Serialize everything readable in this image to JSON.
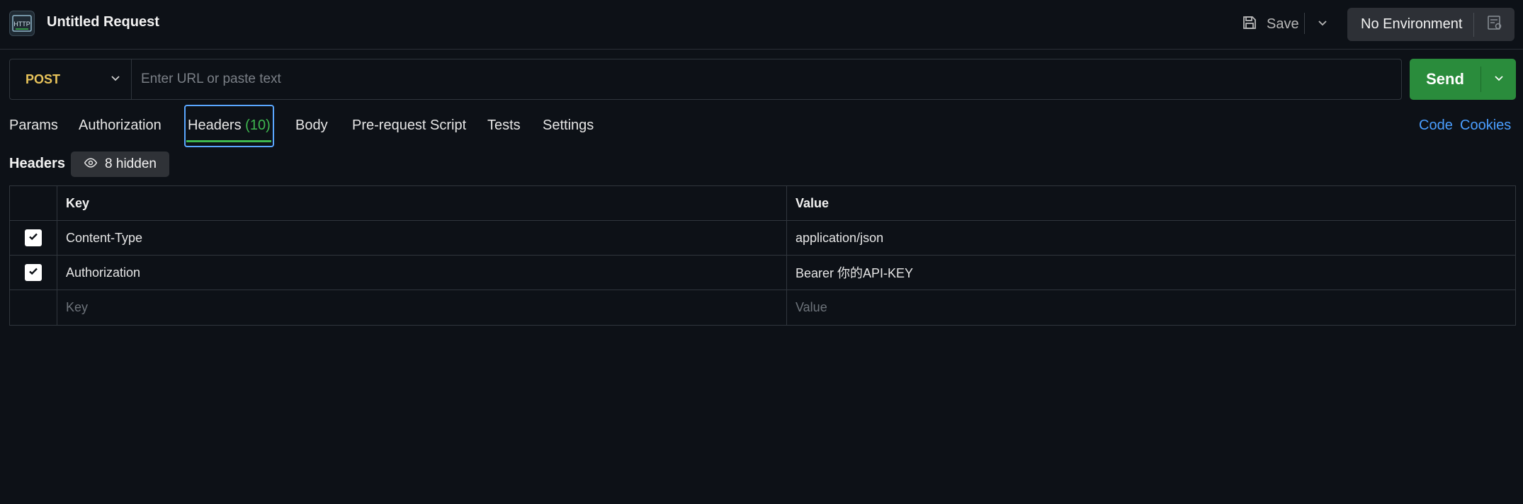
{
  "header": {
    "app_icon_text": "HTTP",
    "title": "Untitled Request",
    "save_label": "Save",
    "environment_label": "No Environment"
  },
  "request": {
    "method": "POST",
    "url_placeholder": "Enter URL or paste text",
    "url_value": "",
    "send_label": "Send"
  },
  "tabs": {
    "params": "Params",
    "authorization": "Authorization",
    "headers": "Headers",
    "headers_count": "(10)",
    "body": "Body",
    "prerequest": "Pre-request Script",
    "tests": "Tests",
    "settings": "Settings",
    "active": "headers"
  },
  "links": {
    "code": "Code",
    "cookies": "Cookies"
  },
  "headers_section": {
    "label": "Headers",
    "hidden_label": "8 hidden",
    "columns": {
      "key": "Key",
      "value": "Value"
    },
    "rows": [
      {
        "checked": true,
        "key": "Content-Type",
        "value": "application/json"
      },
      {
        "checked": true,
        "key": "Authorization",
        "value": "Bearer 你的API-KEY"
      }
    ],
    "new_row": {
      "key_placeholder": "Key",
      "value_placeholder": "Value"
    }
  },
  "colors": {
    "background": "#0d1117",
    "accent_green": "#3fb950",
    "send_green": "#2a8c3c",
    "method_yellow": "#e8c35a",
    "link_blue": "#4a9eff",
    "focus_blue": "#5aa7ff"
  }
}
